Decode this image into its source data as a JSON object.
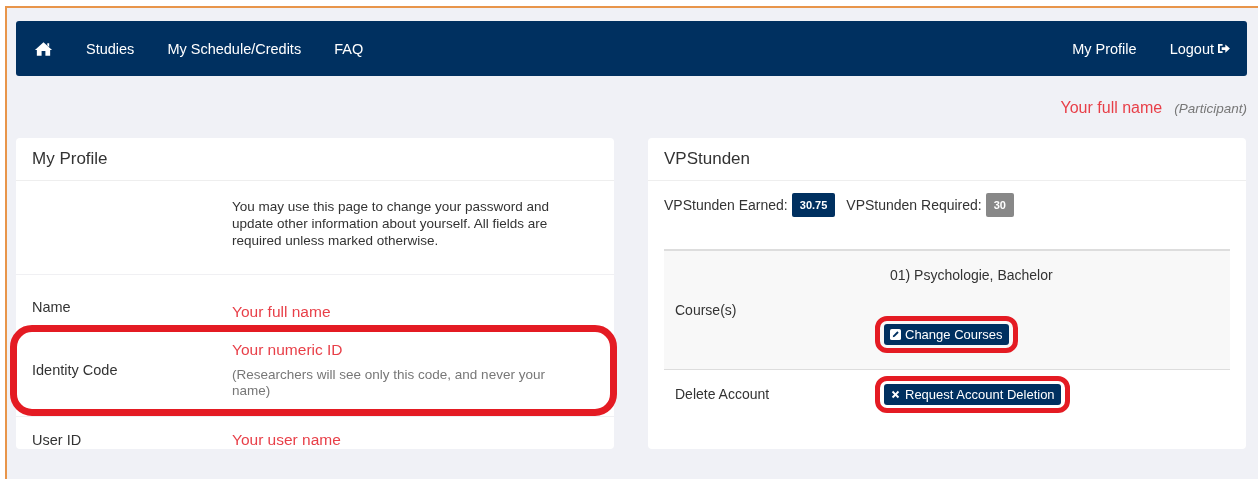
{
  "nav": {
    "left": [
      {
        "kind": "home"
      },
      {
        "kind": "link",
        "label": "Studies"
      },
      {
        "kind": "link",
        "label": "My Schedule/Credits"
      },
      {
        "kind": "link",
        "label": "FAQ"
      }
    ],
    "right": [
      {
        "kind": "link",
        "label": "My Profile"
      },
      {
        "kind": "logout",
        "label": "Logout"
      }
    ]
  },
  "user": {
    "name": "Your full name",
    "role": "(Participant)"
  },
  "profile": {
    "title": "My Profile",
    "intro": "You may use this page to change your password and update other information about yourself. All fields are required unless marked otherwise.",
    "rows": [
      {
        "label": "Name",
        "value": "Your full name",
        "highlighted": false
      },
      {
        "label": "Identity Code",
        "value": "Your numeric ID",
        "note": "(Researchers will see only this code, and never your name)",
        "highlighted": true
      },
      {
        "label": "User ID",
        "value": "Your user name",
        "highlighted": false
      }
    ]
  },
  "credits": {
    "title": "VPStunden",
    "earned_label": "VPStunden Earned:",
    "earned": "30.75",
    "required_label": "VPStunden Required:",
    "required": "30",
    "rows": [
      {
        "label": "Course(s)",
        "value": "01) Psychologie, Bachelor",
        "button": {
          "kind": "edit",
          "label": "Change Courses",
          "highlighted": true
        }
      },
      {
        "label": "Delete Account",
        "button": {
          "kind": "delete",
          "label": "Request Account Deletion",
          "highlighted": true
        }
      }
    ]
  }
}
